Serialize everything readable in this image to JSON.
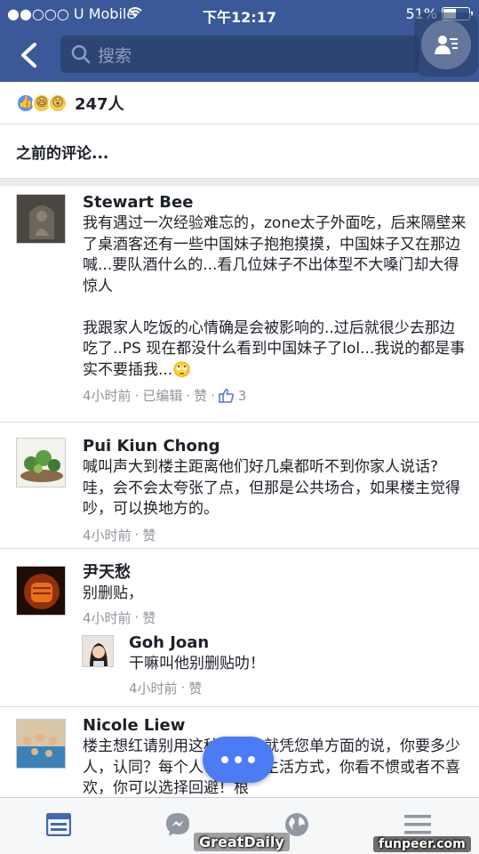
{
  "status": {
    "carrier": "●●○○○ U Mobile",
    "time": "下午12:17",
    "battery": "51%",
    "battery_level": 0.51
  },
  "header": {
    "search_placeholder": "搜索"
  },
  "reactions": {
    "icons": [
      "like-icon",
      "haha-icon",
      "wow-icon"
    ],
    "count": "247人"
  },
  "previous_comments": "之前的评论...",
  "comments": [
    {
      "name": "Stewart Bee",
      "text": "我有遇过一次经验难忘的，zone太子外面吃，后来隔壁来了桌酒客还有一些中国妹子抱抱摸摸，中国妹子又在那边喊...要队酒什么的...看几位妹子不出体型不大嗓门却大得惊人\n\n我跟家人吃饭的心情确是会被影响的..过后就很少去那边吃了..PS 现在都没什么看到中国妹子了lol...我说的都是事实不要插我...🙄",
      "time": "4小时前",
      "edited": "已编辑",
      "like": "赞",
      "likes": "3"
    },
    {
      "name": "Pui Kiun  Chong",
      "text": "喊叫声大到楼主距离他们好几桌都听不到你家人说话?哇，会不会太夸张了点，但那是公共场合，如果楼主觉得吵，可以换地方的。",
      "time": "4小时前",
      "like": "赞"
    },
    {
      "name": "尹天愁",
      "text": "别删贴，",
      "time": "4小时前",
      "like": "赞"
    },
    {
      "name": "Goh Joan",
      "text": "干嘛叫他别删贴叻！",
      "time": "4小时前",
      "like": "赞"
    },
    {
      "name": "Nicole Liew",
      "text": "楼主想红请别用这种方式，就凭您单方面的说，你要多少人，认同？每个人有自己的生活方式，你看不惯或者不喜欢，你可以选择回避！根"
    }
  ],
  "meta_sep": "·",
  "watermarks": {
    "left": "GreatDaily",
    "right": "funpeer.com"
  },
  "tabs": [
    "news-feed-icon",
    "messenger-icon",
    "globe-icon",
    "menu-icon"
  ]
}
